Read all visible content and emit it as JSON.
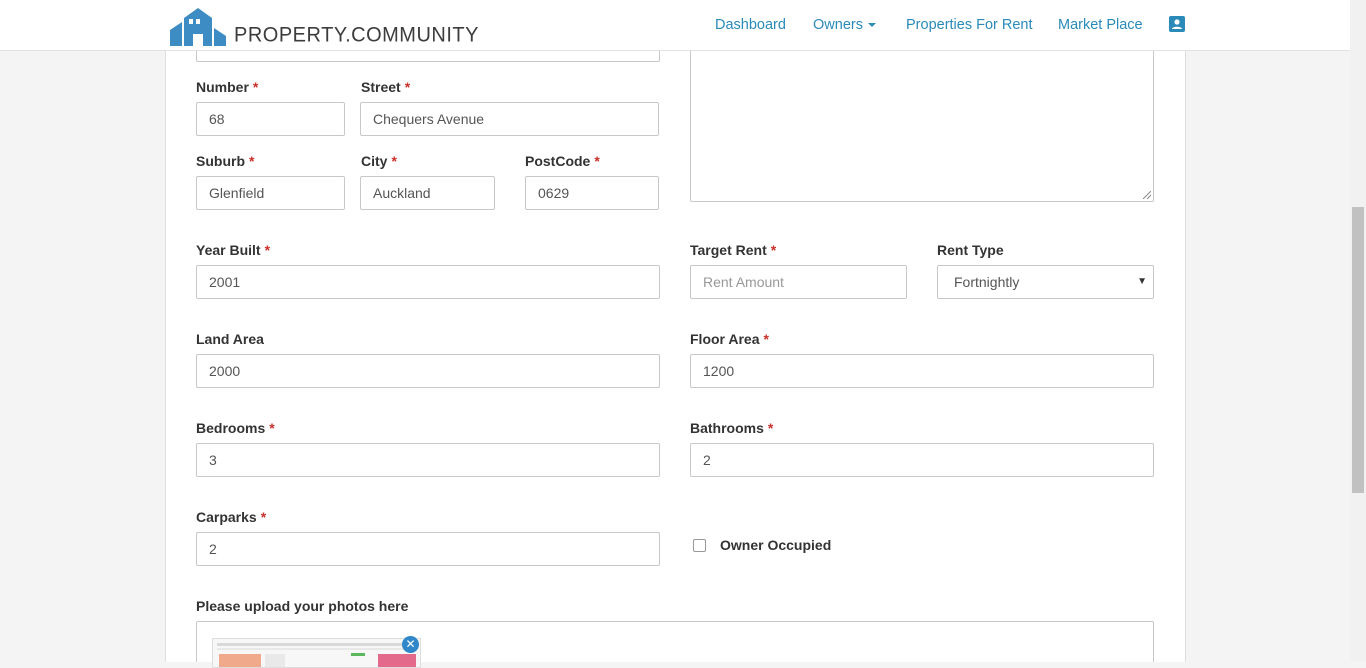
{
  "brand": {
    "name": "PROPERTY.COMMUNITY"
  },
  "nav": {
    "items": [
      {
        "label": "Dashboard"
      },
      {
        "label": "Owners"
      },
      {
        "label": "Properties For Rent"
      },
      {
        "label": "Market Place"
      }
    ],
    "profile_icon": "account-box-icon"
  },
  "form": {
    "number": {
      "label": "Number",
      "value": "68"
    },
    "street": {
      "label": "Street",
      "value": "Chequers Avenue"
    },
    "suburb": {
      "label": "Suburb",
      "value": "Glenfield"
    },
    "city": {
      "label": "City",
      "value": "Auckland"
    },
    "postcode": {
      "label": "PostCode",
      "value": "0629"
    },
    "year_built": {
      "label": "Year Built",
      "value": "2001"
    },
    "target_rent": {
      "label": "Target Rent",
      "placeholder": "Rent Amount"
    },
    "rent_type": {
      "label": "Rent Type",
      "value": "Fortnightly"
    },
    "land_area": {
      "label": "Land Area",
      "value": "2000"
    },
    "floor_area": {
      "label": "Floor Area",
      "value": "1200"
    },
    "bedrooms": {
      "label": "Bedrooms",
      "value": "3"
    },
    "bathrooms": {
      "label": "Bathrooms",
      "value": "2"
    },
    "carparks": {
      "label": "Carparks",
      "value": "2"
    },
    "owner_occupied": {
      "label": "Owner Occupied",
      "checked": false
    },
    "upload": {
      "label": "Please upload your photos here"
    },
    "required_marker": "*"
  },
  "colors": {
    "link": "#2a8ab8",
    "required": "#c9302c",
    "remove_button": "#2f86c9"
  }
}
